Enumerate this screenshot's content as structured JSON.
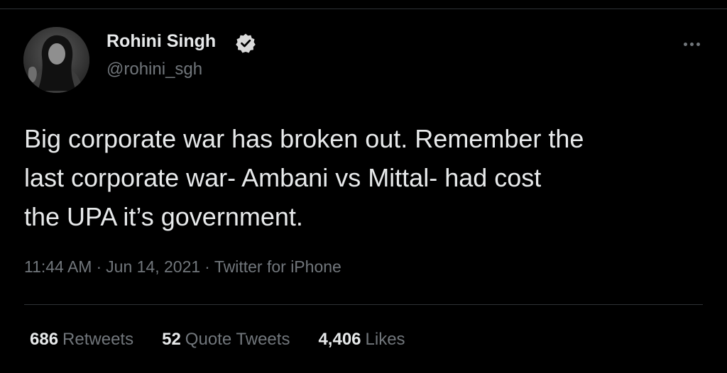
{
  "author": {
    "name": "Rohini Singh",
    "handle": "@rohini_sgh",
    "verified_icon": "verified-badge-icon"
  },
  "tweet": {
    "lines": [
      "Big corporate war has broken out. Remember the",
      "last corporate war- Ambani vs Mittal- had cost",
      "the UPA it’s government."
    ]
  },
  "meta": {
    "time": "11:44 AM",
    "separator": "·",
    "date": "Jun 14, 2021",
    "source": "Twitter for iPhone"
  },
  "stats": {
    "retweets": {
      "count": "686",
      "label": "Retweets"
    },
    "quote_tweets": {
      "count": "52",
      "label": "Quote Tweets"
    },
    "likes": {
      "count": "4,406",
      "label": "Likes"
    }
  },
  "colors": {
    "background": "#000000",
    "text_primary": "#e7e9ea",
    "text_secondary": "#71767b",
    "divider": "#2f3336"
  }
}
